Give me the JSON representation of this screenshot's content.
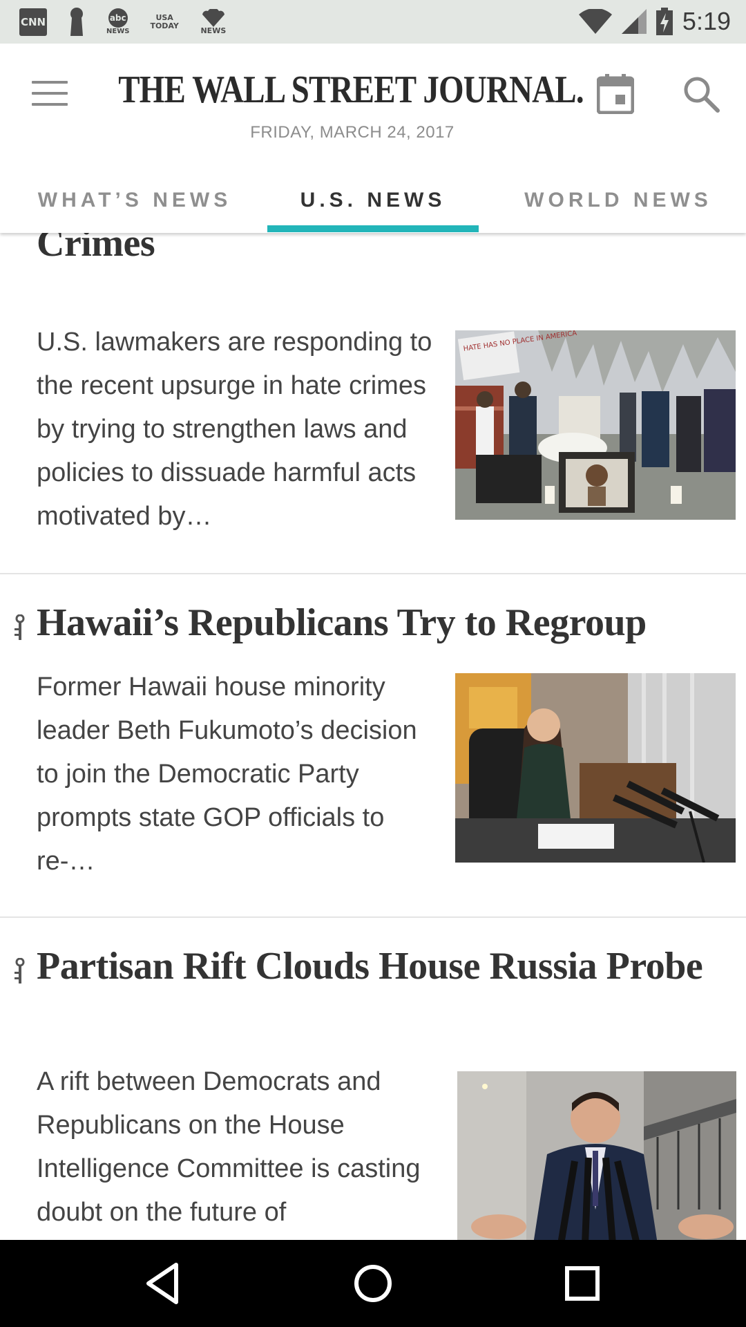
{
  "status_bar": {
    "time": "5:19",
    "notification_icons": [
      {
        "name": "cnn-icon",
        "label": "CNN"
      },
      {
        "name": "pin-icon",
        "label": ""
      },
      {
        "name": "abc-news-icon",
        "line1": "abc",
        "line2": "NEWS"
      },
      {
        "name": "usa-today-icon",
        "line1": "USA",
        "line2": "TODAY"
      },
      {
        "name": "nbc-news-icon",
        "line2": "NEWS"
      }
    ]
  },
  "header": {
    "masthead": "THE WALL STREET JOURNAL.",
    "date": "FRIDAY, MARCH 24, 2017"
  },
  "tabs": [
    {
      "label": "WHAT’S NEWS",
      "active": false
    },
    {
      "label": "U.S. NEWS",
      "active": true
    },
    {
      "label": "WORLD NEWS",
      "active": false
    }
  ],
  "articles": [
    {
      "headline": "Crimes",
      "summary": "U.S. lawmakers are responding to the recent upsurge in hate crimes by trying to strengthen laws and policies to dissuade harmful acts motivated by…",
      "image_sign_text": "HATE HAS NO PLACE IN AMERICA"
    },
    {
      "headline": "Hawaii’s Republicans Try to Regroup",
      "summary": "Former Hawaii house minority leader Beth Fukumoto’s decision to join the Democratic Party prompts state GOP officials to re-…"
    },
    {
      "headline": "Partisan Rift Clouds House Russia Probe",
      "summary": "A rift between Democrats and Republicans on the House Intelligence Committee is casting doubt on the future of"
    }
  ],
  "colors": {
    "accent": "#22b5b9",
    "status_bar_bg": "#e3e7e3",
    "headline_text": "#333333",
    "nav_bar_bg": "#000000"
  }
}
